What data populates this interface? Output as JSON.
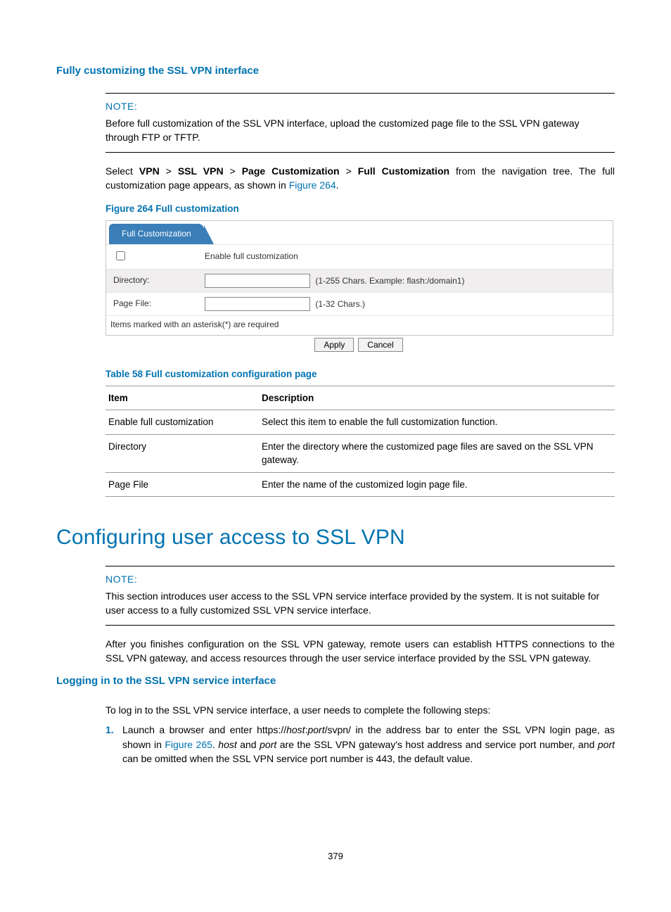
{
  "section1": {
    "title": "Fully customizing the SSL VPN interface",
    "note_title": "NOTE:",
    "note_text": "Before full customization of the SSL VPN interface, upload the customized page file to the SSL VPN gateway through FTP or TFTP.",
    "nav_prefix": "Select ",
    "nav_vpn": "VPN",
    "nav_sep": " > ",
    "nav_sslvpn": "SSL VPN",
    "nav_pagecust": "Page Customization",
    "nav_fullcust": "Full Customization",
    "nav_suffix": " from the navigation tree. The full customization page appears, as shown in ",
    "fig_link": "Figure 264",
    "nav_end": ".",
    "fig_caption": "Figure 264 Full customization"
  },
  "shot": {
    "tab": "Full Customization",
    "enable_label": "Enable full customization",
    "dir_label": "Directory:",
    "dir_hint": "(1-255 Chars. Example: flash:/domain1)",
    "pagefile_label": "Page File:",
    "pagefile_hint": "(1-32 Chars.)",
    "req_note": "Items marked with an asterisk(*) are required",
    "apply": "Apply",
    "cancel": "Cancel"
  },
  "table58": {
    "caption": "Table 58 Full customization configuration page",
    "h_item": "Item",
    "h_desc": "Description",
    "rows": [
      {
        "item": "Enable full customization",
        "desc": "Select this item to enable the full customization function."
      },
      {
        "item": "Directory",
        "desc": "Enter the directory where the customized page files are saved on the SSL VPN gateway."
      },
      {
        "item": "Page File",
        "desc": "Enter the name of the customized login page file."
      }
    ]
  },
  "section2": {
    "title": "Configuring user access to SSL VPN",
    "note_title": "NOTE:",
    "note_text": "This section introduces user access to the SSL VPN service interface provided by the system. It is not suitable for user access to a fully customized SSL VPN service interface.",
    "para": "After you finishes configuration on the SSL VPN gateway, remote users can establish HTTPS connections to the SSL VPN gateway, and access resources through the user service interface provided by the SSL VPN gateway.",
    "sub_title": "Logging in to the SSL VPN service interface",
    "intro": "To log in to the SSL VPN service interface, a user needs to complete the following steps:",
    "step1_num": "1.",
    "step1_a": "Launch a browser and enter https://",
    "step1_host1": "host",
    "step1_colon": ":",
    "step1_port1": "port",
    "step1_b": "/svpn/ in the address bar to enter the SSL VPN login page, as shown in ",
    "step1_link": "Figure 265",
    "step1_c": ". ",
    "step1_host2": "host",
    "step1_d": " and ",
    "step1_port2": "port",
    "step1_e": " are the SSL VPN gateway's host address and service port number, and ",
    "step1_port3": "port",
    "step1_f": " can be omitted when the SSL VPN service port number is 443, the default value."
  },
  "page_number": "379"
}
